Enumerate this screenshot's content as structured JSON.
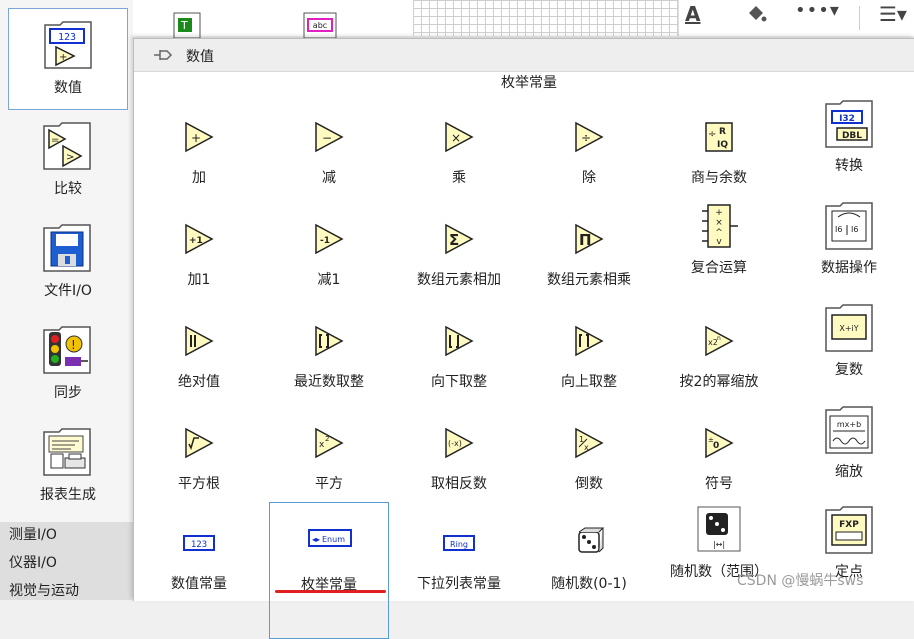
{
  "left_palette": {
    "items": [
      {
        "label": "数值",
        "icon": "numeric-palette-icon"
      },
      {
        "label": "比较",
        "icon": "comparison-palette-icon"
      },
      {
        "label": "文件I/O",
        "icon": "file-io-palette-icon"
      },
      {
        "label": "同步",
        "icon": "synchronization-palette-icon"
      },
      {
        "label": "报表生成",
        "icon": "report-generation-palette-icon"
      }
    ],
    "categories": [
      "测量I/O",
      "仪器I/O",
      "视觉与运动"
    ]
  },
  "popup": {
    "title": "数值",
    "tooltip": "枚举常量",
    "items": [
      {
        "label": "加",
        "icon": "add-icon"
      },
      {
        "label": "减",
        "icon": "subtract-icon"
      },
      {
        "label": "乘",
        "icon": "multiply-icon"
      },
      {
        "label": "除",
        "icon": "divide-icon"
      },
      {
        "label": "商与余数",
        "icon": "quotient-remainder-icon"
      },
      {
        "label": "转换",
        "icon": "conversion-icon"
      },
      {
        "label": "加1",
        "icon": "increment-icon"
      },
      {
        "label": "减1",
        "icon": "decrement-icon"
      },
      {
        "label": "数组元素相加",
        "icon": "add-array-elements-icon"
      },
      {
        "label": "数组元素相乘",
        "icon": "multiply-array-elements-icon"
      },
      {
        "label": "复合运算",
        "icon": "compound-arithmetic-icon"
      },
      {
        "label": "数据操作",
        "icon": "data-manipulation-icon"
      },
      {
        "label": "绝对值",
        "icon": "absolute-value-icon"
      },
      {
        "label": "最近数取整",
        "icon": "round-nearest-icon"
      },
      {
        "label": "向下取整",
        "icon": "round-down-icon"
      },
      {
        "label": "向上取整",
        "icon": "round-up-icon"
      },
      {
        "label": "按2的幂缩放",
        "icon": "scale-by-power-of-2-icon"
      },
      {
        "label": "复数",
        "icon": "complex-icon"
      },
      {
        "label": "平方根",
        "icon": "square-root-icon"
      },
      {
        "label": "平方",
        "icon": "square-icon"
      },
      {
        "label": "取相反数",
        "icon": "negate-icon"
      },
      {
        "label": "倒数",
        "icon": "reciprocal-icon"
      },
      {
        "label": "符号",
        "icon": "sign-icon"
      },
      {
        "label": "缩放",
        "icon": "scaling-icon"
      },
      {
        "label": "数值常量",
        "icon": "numeric-constant-icon"
      },
      {
        "label": "枚举常量",
        "icon": "enum-constant-icon"
      },
      {
        "label": "下拉列表常量",
        "icon": "ring-constant-icon"
      },
      {
        "label": "随机数(0-1)",
        "icon": "random-number-icon"
      },
      {
        "label": "随机数（范围）",
        "icon": "random-number-range-icon"
      },
      {
        "label": "定点",
        "icon": "fixed-point-icon"
      }
    ]
  },
  "watermark": "CSDN @慢蜗牛sws",
  "colors": {
    "selection_border": "#5b9bd5",
    "underline": "#e02020"
  }
}
